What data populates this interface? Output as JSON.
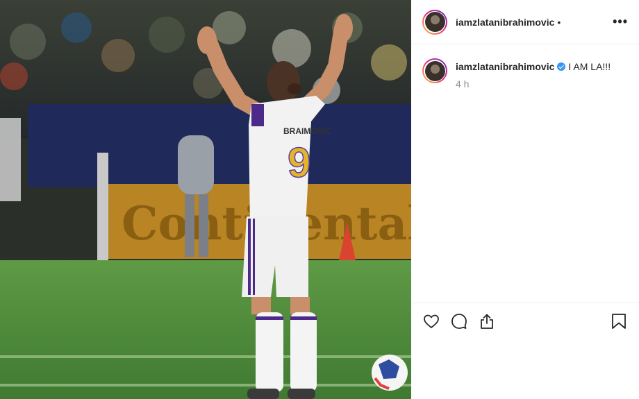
{
  "header": {
    "username": "iamzlatanibrahimovic",
    "separator": "•",
    "more_label": "•••"
  },
  "caption": {
    "username": "iamzlatanibrahimovic",
    "text": "I AM LA!!!",
    "time": "4 h"
  },
  "photo": {
    "jersey_name": "BRAIMOVIĆ",
    "jersey_number": "9",
    "banner_text": "Continental"
  },
  "icons": {
    "like": "heart-icon",
    "comment": "comment-icon",
    "share": "share-icon",
    "save": "bookmark-icon",
    "verified": "verified-badge-icon"
  },
  "colors": {
    "verified": "#3897f0",
    "secondary_text": "#8e8e8e"
  }
}
